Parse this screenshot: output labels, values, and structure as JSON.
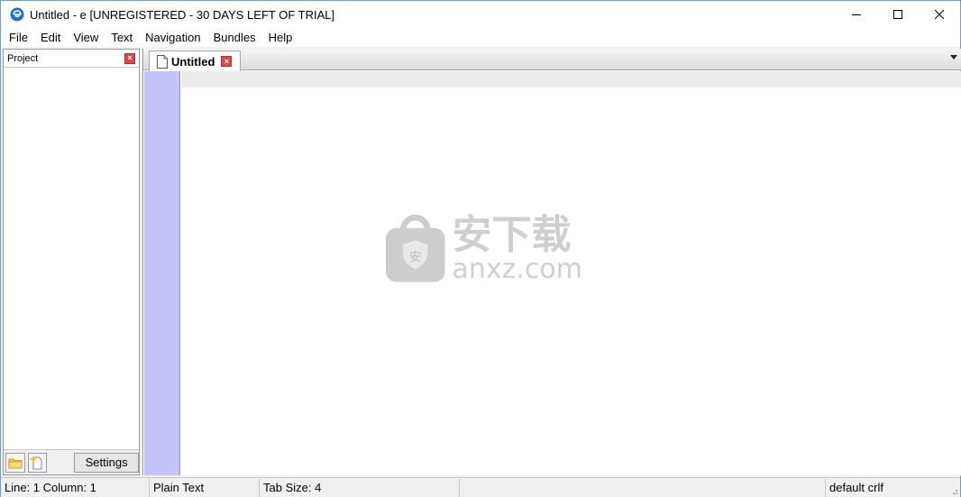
{
  "window": {
    "title": "Untitled - e  [UNREGISTERED - 30 DAYS LEFT OF TRIAL]",
    "controls": [
      "minimize",
      "maximize",
      "close"
    ]
  },
  "menu": {
    "items": [
      {
        "label": "File"
      },
      {
        "label": "Edit"
      },
      {
        "label": "View"
      },
      {
        "label": "Text"
      },
      {
        "label": "Navigation"
      },
      {
        "label": "Bundles"
      },
      {
        "label": "Help"
      }
    ]
  },
  "project": {
    "title": "Project",
    "settings_label": "Settings",
    "icons": [
      "open-folder-icon",
      "new-file-icon"
    ]
  },
  "editor": {
    "tabs": [
      {
        "label": "Untitled",
        "active": true
      }
    ],
    "gutter_color": "#c4c4f9"
  },
  "watermark": {
    "cn": "安下载",
    "en": "anxz.com"
  },
  "status": {
    "position": "Line: 1  Column: 1",
    "mode": "Plain Text",
    "tab_size": "Tab Size: 4",
    "eol": "default crlf"
  },
  "colors": {
    "window_border": "#7a9bc6",
    "close_red": "#d94a4a",
    "gutter": "#c4c4f9"
  }
}
